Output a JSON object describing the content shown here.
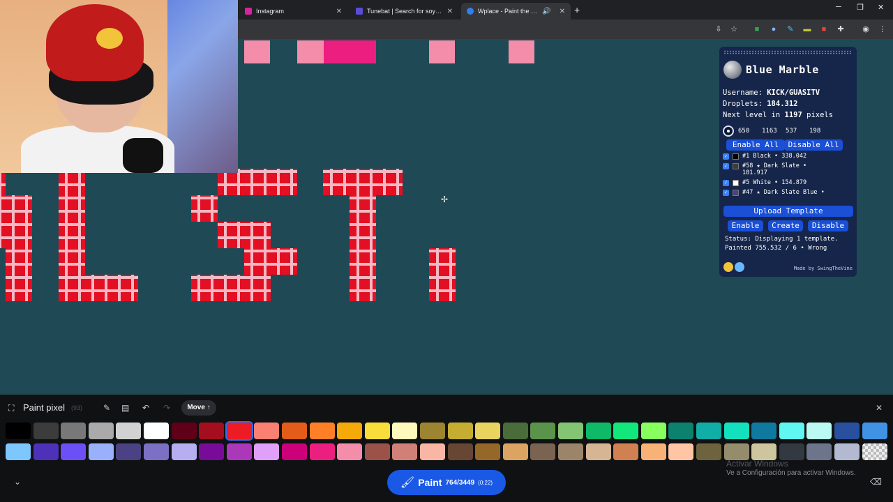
{
  "browser": {
    "tabs": [
      {
        "title": "Instagram",
        "favicon_color": "#d6249f"
      },
      {
        "title": "Tunebat | Search for soy famoso",
        "favicon_color": "#5b4bdb"
      },
      {
        "title": "Wplace - Paint the world",
        "favicon_color": "#2f80ed"
      }
    ],
    "new_tab": "+",
    "controls": {
      "minimize": "─",
      "restore": "❐",
      "close": "✕"
    }
  },
  "blue_marble": {
    "title": "Blue Marble",
    "username_label": "Username:",
    "username": "KICK/GUASITV",
    "droplets_label": "Droplets:",
    "droplets": "184.312",
    "next_level_prefix": "Next level in",
    "next_level_pixels": "1197",
    "next_level_suffix": "pixels",
    "coords": [
      "650",
      "1163",
      "537",
      "198"
    ],
    "enable_all": "Enable All",
    "disable_all": "Disable All",
    "colors": [
      {
        "label": "#1 Black • 338.042",
        "swatch": "#000000"
      },
      {
        "label": "#58 ★ Dark Slate • 181.917",
        "swatch": "#3c3c3c"
      },
      {
        "label": "#5 White • 154.879",
        "swatch": "#ffffff"
      },
      {
        "label": "#47 ★ Dark Slate Blue •",
        "swatch": "#4a4284"
      }
    ],
    "upload_template": "Upload Template",
    "enable": "Enable",
    "create": "Create",
    "disable": "Disable",
    "status": "Status: Displaying 1 template.",
    "status_2": "Painted 755.532 / 6 • Wrong",
    "made_by": "Made by SwingTheVine"
  },
  "bottom_bar": {
    "title": "Paint pixel",
    "count": "(93)",
    "move_label": "Move ↑",
    "paint_label": "Paint",
    "paint_count": "764/3449",
    "paint_timer": "(0:22)",
    "activate_title": "Activar Windows",
    "activate_sub": "Ve a Configuración para activar Windows."
  },
  "palette_row1": [
    "#000000",
    "#3c3c3c",
    "#787878",
    "#aaaaaa",
    "#d2d2d2",
    "#ffffff",
    "#600018",
    "#a50e1e",
    "#ed1c24",
    "#fa8072",
    "#e45c1a",
    "#ff7f27",
    "#f6aa09",
    "#f9dd3b",
    "#fffabc",
    "#9c8431",
    "#c5ad31",
    "#e8d45f",
    "#4a6b3a",
    "#5a944a",
    "#84c573",
    "#0eb968",
    "#13e67b",
    "#87ff5e",
    "#0c816e",
    "#10aea6",
    "#13e1be",
    "#0f799f",
    "#60f7f2",
    "#bbfaf2",
    "#28509e",
    "#4093e4"
  ],
  "palette_row2": [
    "#7dc7ff",
    "#4d31b8",
    "#6b50f6",
    "#99b1fb",
    "#4a4284",
    "#7a71c4",
    "#b5aef1",
    "#780c99",
    "#aa38b9",
    "#e09ff9",
    "#cb007a",
    "#ec1f80",
    "#f38da9",
    "#9b5249",
    "#d18078",
    "#fab6a4",
    "#684634",
    "#95682a",
    "#dba463",
    "#7b6352",
    "#9c846b",
    "#d6b594",
    "#d18051",
    "#f8b277",
    "#ffc5a5",
    "#6d643f",
    "#948c6b",
    "#cdc59e",
    "#333941",
    "#6d758d",
    "#b3b9d1",
    "transparent"
  ],
  "selected_color_index": 8
}
